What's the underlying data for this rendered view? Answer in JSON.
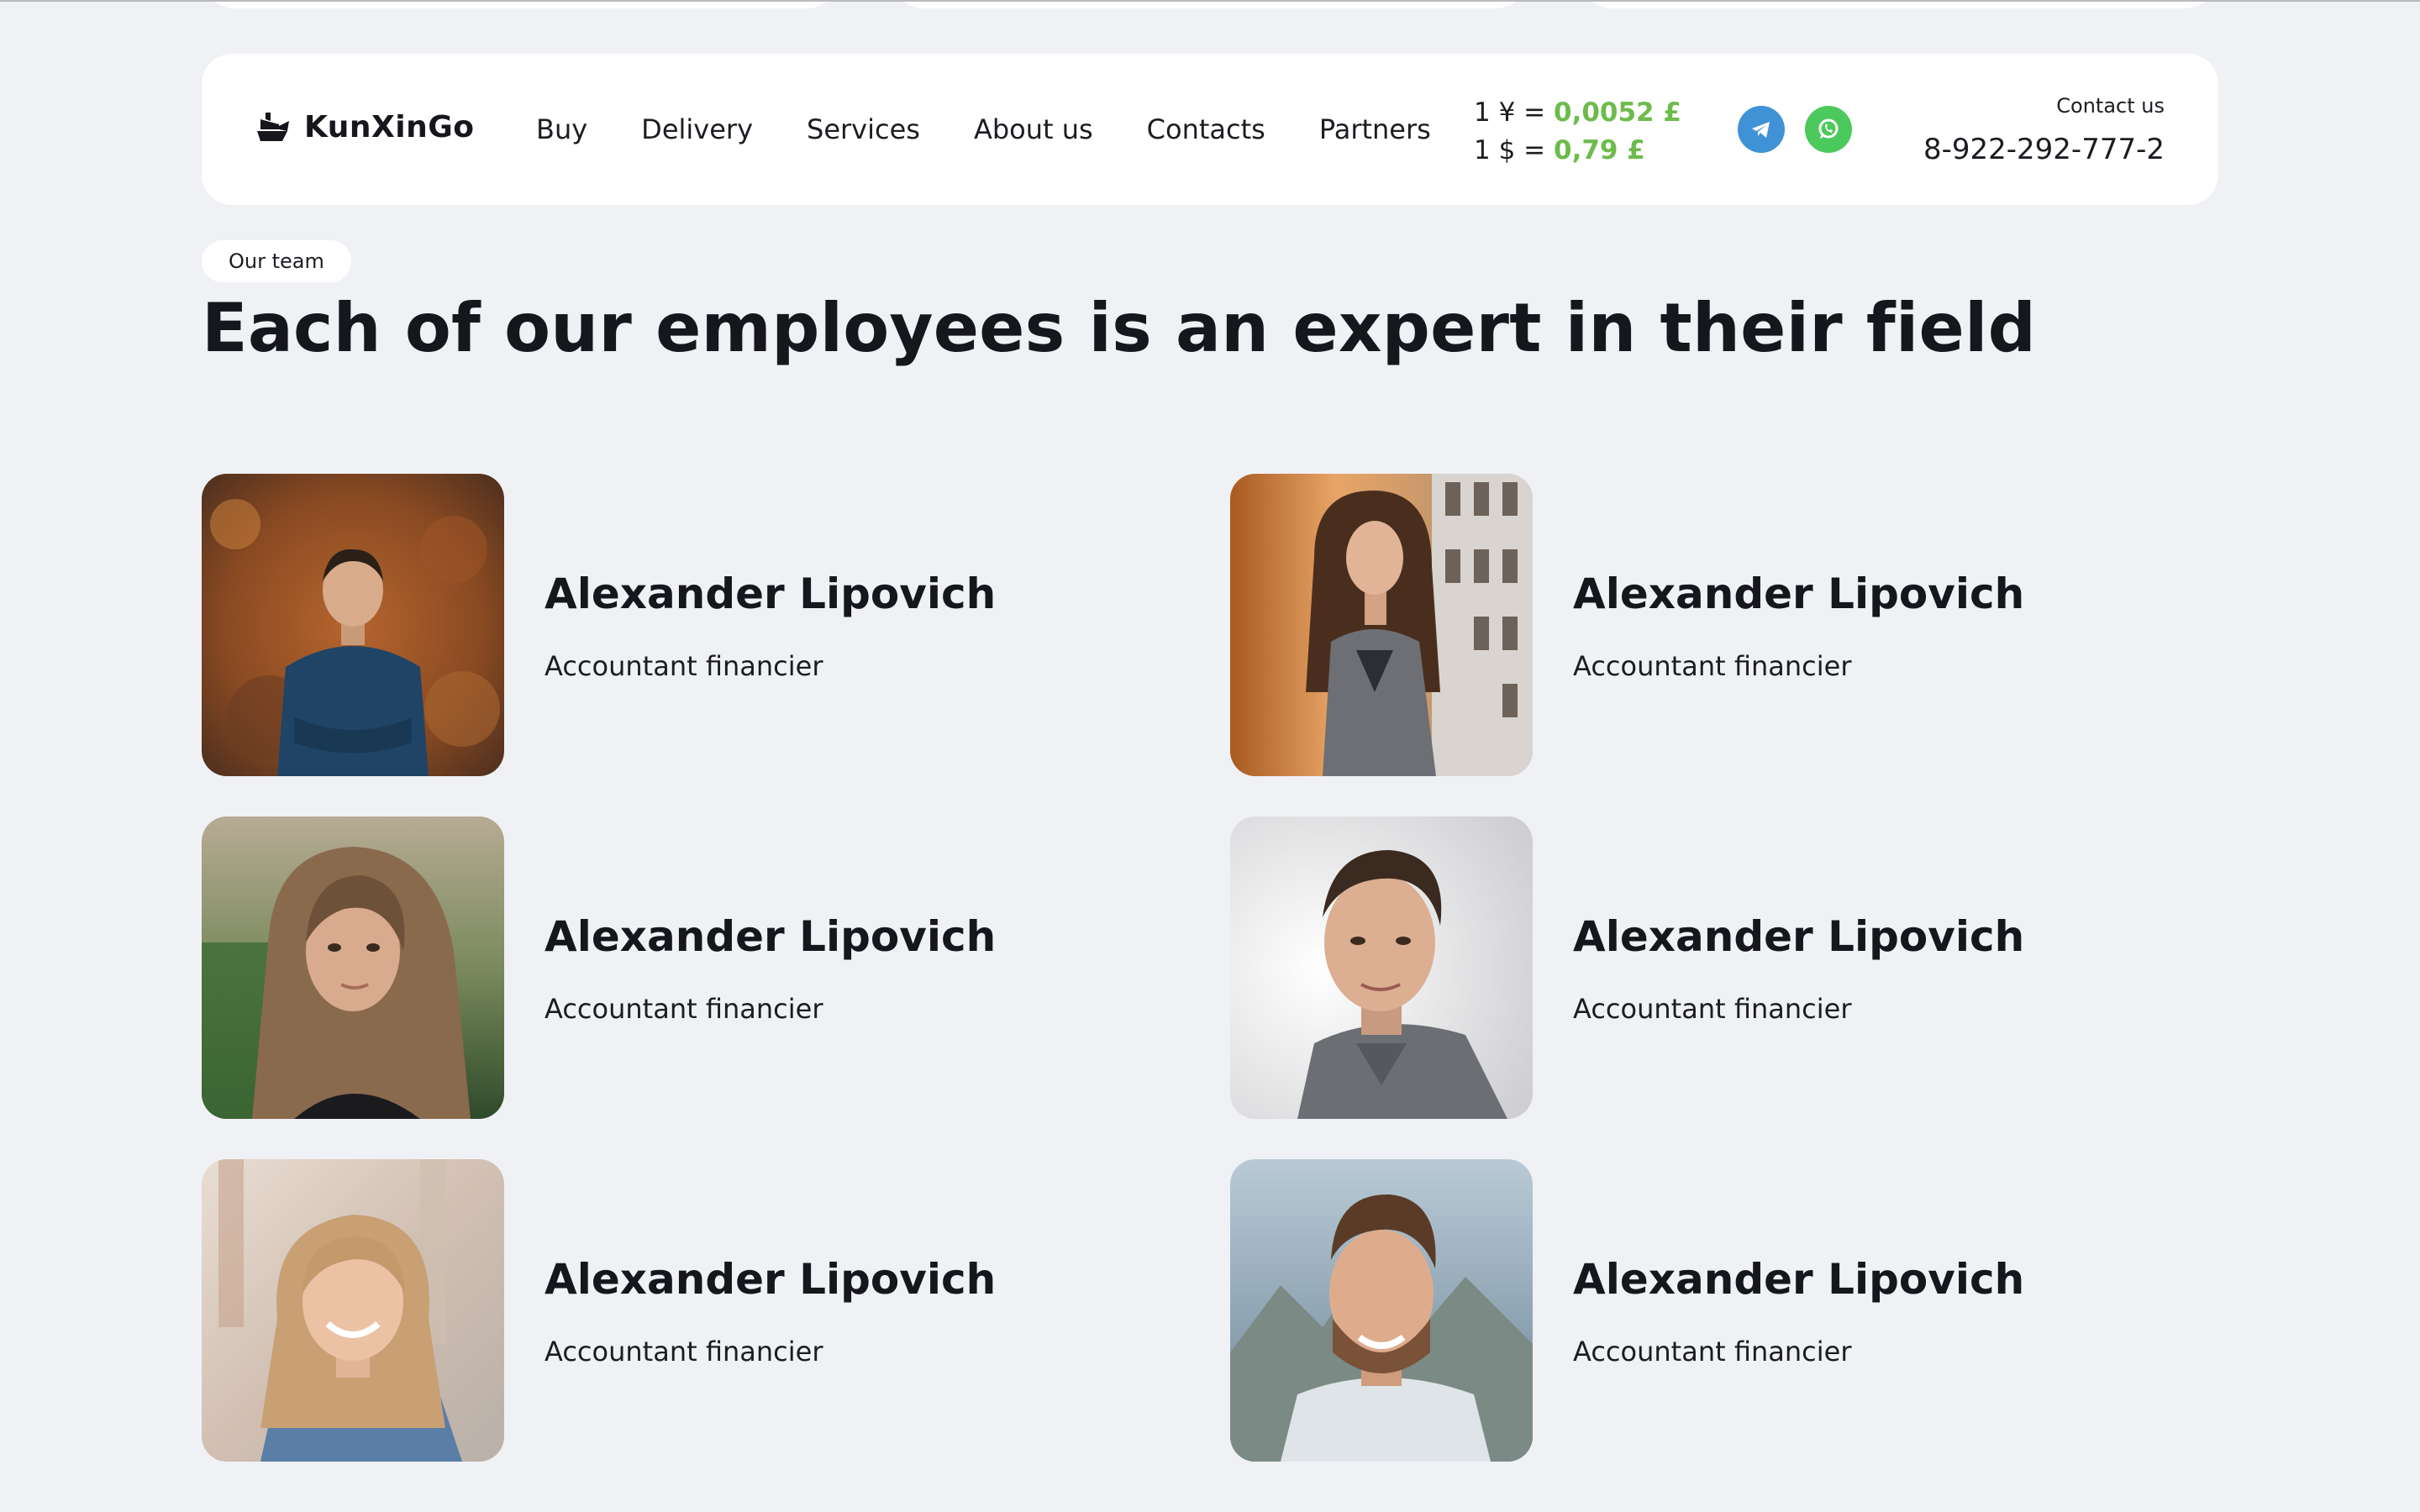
{
  "header": {
    "logo_text": "KunXinGo",
    "nav": [
      {
        "label": "Buy"
      },
      {
        "label": "Delivery"
      },
      {
        "label": "Services"
      },
      {
        "label": "About us"
      },
      {
        "label": "Contacts"
      },
      {
        "label": "Partners"
      }
    ],
    "rates": [
      {
        "prefix": "1 ¥ =",
        "value": "0,0052 £"
      },
      {
        "prefix": "1 $ =",
        "value": "0,79 £"
      }
    ],
    "social": [
      {
        "icon": "telegram-icon",
        "color": "#3f92d6"
      },
      {
        "icon": "whatsapp-icon",
        "color": "#4cc95c"
      }
    ],
    "contact_label": "Contact us",
    "contact_phone": "8-922-292-777-2"
  },
  "section": {
    "badge": "Our team",
    "title": "Each of our employees is an expert in their field"
  },
  "team": [
    {
      "name": "Alexander Lipovich",
      "role": "Accountant financier"
    },
    {
      "name": "Alexander Lipovich",
      "role": "Accountant financier"
    },
    {
      "name": "Alexander Lipovich",
      "role": "Accountant financier"
    },
    {
      "name": "Alexander Lipovich",
      "role": "Accountant financier"
    },
    {
      "name": "Alexander Lipovich",
      "role": "Accountant financier"
    },
    {
      "name": "Alexander Lipovich",
      "role": "Accountant financier"
    }
  ],
  "colors": {
    "background": "#f0f1f5",
    "surface": "#ffffff",
    "rate_value": "#6dbb4c",
    "text": "#16171c"
  }
}
